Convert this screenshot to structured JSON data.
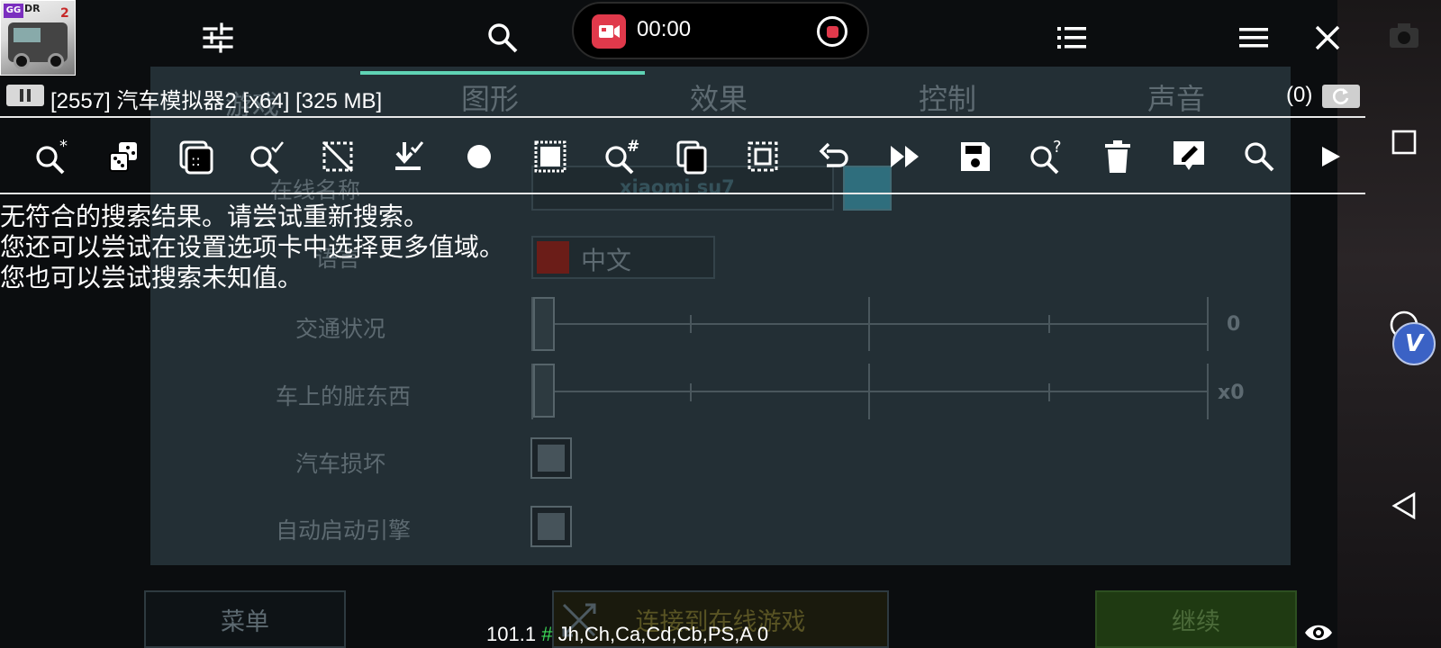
{
  "game": {
    "tabs": [
      "图形",
      "效果",
      "控制",
      "声音"
    ],
    "left_partial_label": "游戏",
    "online_name_label": "在线名称",
    "online_name_value": "xiaomi su7",
    "language_label": "语言",
    "language_value": "中文",
    "traffic_label": "交通状况",
    "traffic_value": "0",
    "dirt_label": "车上的脏东西",
    "dirt_value": "x0",
    "damage_label": "汽车损坏",
    "autostart_label": "自动启动引擎",
    "menu_button": "菜单",
    "connect_button": "连接到在线游戏",
    "continue_button": "继续"
  },
  "recorder": {
    "time": "00:00"
  },
  "process": {
    "text": "[2557] 汽车模拟器2 [x64] [325 MB]",
    "count": "(0)"
  },
  "tools": [
    "search-star-icon",
    "dice-icon",
    "fuzzy-search-icon",
    "search-check-icon",
    "select-dashed-icon",
    "download-check-icon",
    "record-dot-icon",
    "chip-icon",
    "search-hash-icon",
    "copy-icon",
    "select-box-icon",
    "undo-icon",
    "fast-forward-icon",
    "save-icon",
    "search-question-icon",
    "delete-icon",
    "edit-tag-icon",
    "search-icon",
    "play-icon"
  ],
  "message": {
    "line1": "无符合的搜索结果。请尝试重新搜索。",
    "line2": "您还可以尝试在设置选项卡中选择更多值域。",
    "line3": "您也可以尝试搜索未知值。"
  },
  "bottom": {
    "version": "101.1",
    "hash": "#",
    "flags": "Jh,Ch,Ca,Cd,Cb,PS,A 0"
  },
  "colors": {
    "accent": "#5fd3b4",
    "record_red": "#e0394b",
    "hash_green": "#3ddc57",
    "panel_bg": "#263238"
  }
}
